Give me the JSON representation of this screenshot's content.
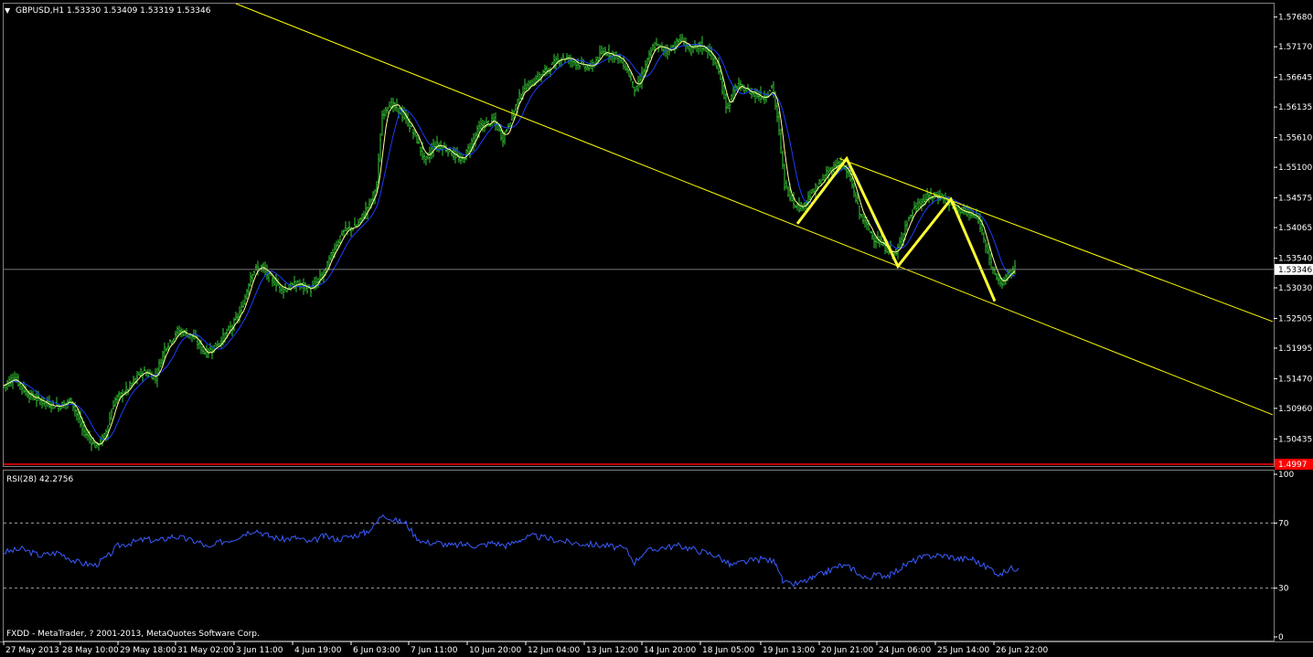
{
  "chart_data": {
    "type": "ohlc",
    "title": "GBPUSD,H1  1.53330 1.53409 1.53319 1.53346",
    "symbol": "GBPUSD",
    "timeframe": "H1",
    "last_bar": {
      "open": 1.5333,
      "high": 1.53409,
      "low": 1.53319,
      "close": 1.53346
    },
    "price_ticks": [
      "1.57680",
      "1.57170",
      "1.56645",
      "1.56135",
      "1.55610",
      "1.55100",
      "1.54575",
      "1.54065",
      "1.53540",
      "1.53030",
      "1.52505",
      "1.51995",
      "1.51470",
      "1.50960",
      "1.50435"
    ],
    "current_price_label": "1.53346",
    "red_line_label": "1.4997",
    "ylim": [
      1.4997,
      1.5791
    ],
    "time_ticks": [
      "27 May 2013",
      "28 May 10:00",
      "29 May 18:00",
      "31 May 02:00",
      "3 Jun 11:00",
      "4 Jun 19:00",
      "6 Jun 03:00",
      "7 Jun 11:00",
      "10 Jun 20:00",
      "12 Jun 04:00",
      "13 Jun 12:00",
      "14 Jun 20:00",
      "18 Jun 05:00",
      "19 Jun 13:00",
      "20 Jun 21:00",
      "24 Jun 06:00",
      "25 Jun 14:00",
      "26 Jun 22:00"
    ],
    "price_path": [
      [
        0,
        1.513
      ],
      [
        15,
        1.515
      ],
      [
        30,
        1.512
      ],
      [
        50,
        1.5105
      ],
      [
        65,
        1.51
      ],
      [
        78,
        1.511
      ],
      [
        90,
        1.506
      ],
      [
        105,
        1.503
      ],
      [
        115,
        1.505
      ],
      [
        125,
        1.511
      ],
      [
        140,
        1.513
      ],
      [
        155,
        1.516
      ],
      [
        170,
        1.515
      ],
      [
        180,
        1.52
      ],
      [
        195,
        1.523
      ],
      [
        210,
        1.522
      ],
      [
        225,
        1.519
      ],
      [
        240,
        1.521
      ],
      [
        255,
        1.524
      ],
      [
        265,
        1.527
      ],
      [
        275,
        1.533
      ],
      [
        285,
        1.534
      ],
      [
        295,
        1.532
      ],
      [
        310,
        1.53
      ],
      [
        325,
        1.531
      ],
      [
        340,
        1.53
      ],
      [
        355,
        1.533
      ],
      [
        365,
        1.537
      ],
      [
        375,
        1.54
      ],
      [
        390,
        1.541
      ],
      [
        405,
        1.545
      ],
      [
        412,
        1.548
      ],
      [
        418,
        1.56
      ],
      [
        425,
        1.562
      ],
      [
        435,
        1.561
      ],
      [
        445,
        1.559
      ],
      [
        455,
        1.556
      ],
      [
        465,
        1.552
      ],
      [
        475,
        1.555
      ],
      [
        490,
        1.554
      ],
      [
        505,
        1.552
      ],
      [
        515,
        1.555
      ],
      [
        525,
        1.558
      ],
      [
        540,
        1.559
      ],
      [
        550,
        1.556
      ],
      [
        560,
        1.56
      ],
      [
        570,
        1.564
      ],
      [
        585,
        1.566
      ],
      [
        600,
        1.568
      ],
      [
        615,
        1.57
      ],
      [
        630,
        1.569
      ],
      [
        645,
        1.568
      ],
      [
        660,
        1.571
      ],
      [
        675,
        1.57
      ],
      [
        685,
        1.568
      ],
      [
        695,
        1.564
      ],
      [
        705,
        1.568
      ],
      [
        715,
        1.572
      ],
      [
        730,
        1.571
      ],
      [
        745,
        1.573
      ],
      [
        755,
        1.571
      ],
      [
        765,
        1.572
      ],
      [
        775,
        1.571
      ],
      [
        785,
        1.568
      ],
      [
        795,
        1.561
      ],
      [
        805,
        1.565
      ],
      [
        820,
        1.564
      ],
      [
        835,
        1.563
      ],
      [
        845,
        1.565
      ],
      [
        852,
        1.557
      ],
      [
        858,
        1.548
      ],
      [
        868,
        1.545
      ],
      [
        875,
        1.544
      ],
      [
        890,
        1.547
      ],
      [
        905,
        1.55
      ],
      [
        918,
        1.552
      ],
      [
        930,
        1.549
      ],
      [
        940,
        1.543
      ],
      [
        955,
        1.539
      ],
      [
        970,
        1.537
      ],
      [
        980,
        1.536
      ],
      [
        990,
        1.541
      ],
      [
        1000,
        1.544
      ],
      [
        1015,
        1.546
      ],
      [
        1030,
        1.546
      ],
      [
        1045,
        1.544
      ],
      [
        1060,
        1.543
      ],
      [
        1070,
        1.542
      ],
      [
        1078,
        1.538
      ],
      [
        1086,
        1.533
      ],
      [
        1095,
        1.531
      ],
      [
        1105,
        1.533
      ],
      [
        1110,
        1.5335
      ]
    ],
    "trendlines": [
      {
        "from": [
          258,
          1.5791
        ],
        "to": [
          1392,
          1.5085
        ],
        "color": "#ffff00"
      },
      {
        "from": [
          918,
          1.5525
        ],
        "to": [
          1392,
          1.5245
        ],
        "color": "#ffff00"
      }
    ],
    "pattern_path": [
      [
        872,
        1.5413
      ],
      [
        926,
        1.5525
      ],
      [
        982,
        1.534
      ],
      [
        1040,
        1.5455
      ],
      [
        1088,
        1.528
      ]
    ],
    "rsi": {
      "label": "RSI(28) 42.2756",
      "levels": [
        "100",
        "70",
        "30",
        "0"
      ],
      "dashed_levels": [
        70,
        30
      ],
      "path": [
        [
          0,
          52
        ],
        [
          20,
          54
        ],
        [
          40,
          50
        ],
        [
          60,
          52
        ],
        [
          80,
          46
        ],
        [
          100,
          44
        ],
        [
          115,
          50
        ],
        [
          125,
          56
        ],
        [
          140,
          58
        ],
        [
          155,
          60
        ],
        [
          170,
          59
        ],
        [
          185,
          62
        ],
        [
          200,
          60
        ],
        [
          215,
          58
        ],
        [
          225,
          54
        ],
        [
          235,
          58
        ],
        [
          250,
          60
        ],
        [
          265,
          64
        ],
        [
          275,
          66
        ],
        [
          290,
          62
        ],
        [
          305,
          60
        ],
        [
          320,
          61
        ],
        [
          335,
          58
        ],
        [
          350,
          62
        ],
        [
          365,
          60
        ],
        [
          380,
          62
        ],
        [
          395,
          64
        ],
        [
          405,
          68
        ],
        [
          415,
          76
        ],
        [
          425,
          72
        ],
        [
          440,
          70
        ],
        [
          450,
          62
        ],
        [
          460,
          58
        ],
        [
          475,
          58
        ],
        [
          490,
          56
        ],
        [
          505,
          57
        ],
        [
          520,
          56
        ],
        [
          535,
          58
        ],
        [
          550,
          56
        ],
        [
          565,
          60
        ],
        [
          580,
          62
        ],
        [
          600,
          60
        ],
        [
          620,
          58
        ],
        [
          640,
          57
        ],
        [
          660,
          56
        ],
        [
          680,
          54
        ],
        [
          690,
          46
        ],
        [
          700,
          52
        ],
        [
          720,
          55
        ],
        [
          740,
          56
        ],
        [
          760,
          53
        ],
        [
          780,
          50
        ],
        [
          795,
          44
        ],
        [
          810,
          46
        ],
        [
          830,
          48
        ],
        [
          845,
          46
        ],
        [
          852,
          34
        ],
        [
          860,
          32
        ],
        [
          870,
          33
        ],
        [
          885,
          36
        ],
        [
          900,
          40
        ],
        [
          915,
          44
        ],
        [
          930,
          42
        ],
        [
          940,
          36
        ],
        [
          955,
          38
        ],
        [
          970,
          38
        ],
        [
          985,
          44
        ],
        [
          1000,
          48
        ],
        [
          1015,
          50
        ],
        [
          1030,
          50
        ],
        [
          1045,
          48
        ],
        [
          1060,
          48
        ],
        [
          1070,
          44
        ],
        [
          1080,
          42
        ],
        [
          1090,
          38
        ],
        [
          1100,
          42
        ],
        [
          1110,
          42.3
        ]
      ]
    },
    "copyright": "FXDD - MetaTrader, ? 2001-2013, MetaQuotes Software Corp."
  },
  "colors": {
    "background": "#000000",
    "bars": "#33cc33",
    "fast_ma": "#ffff99",
    "slow_ma": "#1c3cff",
    "trendline": "#ffff00",
    "pattern": "#ffff33",
    "rsi": "#3a5cff",
    "red_line": "#ff0000",
    "text": "#ffffff"
  }
}
